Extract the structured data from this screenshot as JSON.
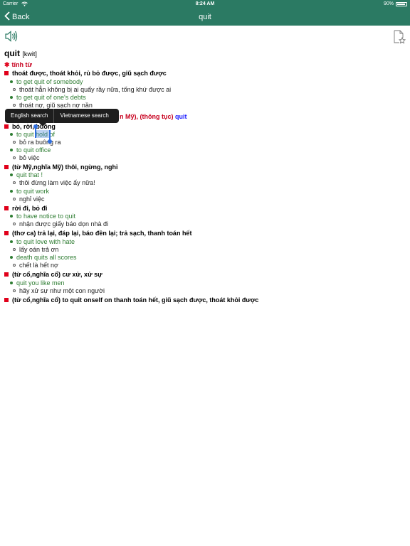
{
  "status_bar": {
    "carrier": "Carrier",
    "time": "8:24 AM",
    "battery": "90%"
  },
  "navbar": {
    "back_label": "Back",
    "title": "quit"
  },
  "icons": {
    "speaker": "speaker-icon",
    "bookmark": "bookmark-star-icon",
    "back": "chevron-left-icon",
    "wifi": "wifi-icon"
  },
  "colors": {
    "nav_bg": "#2b7a63",
    "sense_bullet": "#e0001a",
    "example": "#2e7d32",
    "pos": "#c8001e",
    "link": "#1a1aff"
  },
  "entry": {
    "word": "quit",
    "pronunciation": "[kwit]",
    "pos": "tính từ",
    "senses": [
      {
        "text": "thoát được, thoát khỏi, rủ bỏ được, giũ sạch được"
      },
      {
        "example": "to get quit of somebody"
      },
      {
        "translation": "thoát hẳn không bị ai quấy rầy nữa, tống khứ được ai"
      },
      {
        "example": "to get quit of one's debts"
      },
      {
        "translation": "thoát nợ, giũ sạch nợ nần"
      },
      {
        "partial_red": "n Mỹ), (thông tục)",
        "partial_blue": "quit"
      },
      {
        "text": "bỏ, rời, buông"
      },
      {
        "example": "to quit hold of",
        "selected_word": "hold"
      },
      {
        "translation": "bỏ ra buông ra"
      },
      {
        "example": "to quit office"
      },
      {
        "translation": "bỏ việc"
      },
      {
        "text": "(từ Mỹ,nghĩa Mỹ) thôi, ngừng, nghỉ"
      },
      {
        "example": "quit that !"
      },
      {
        "translation": "thôi đừng làm việc ấy nữa!"
      },
      {
        "example": "to quit work"
      },
      {
        "translation": "nghỉ việc"
      },
      {
        "text": "rời đi, bỏ đi"
      },
      {
        "example": "to have notice to quit"
      },
      {
        "translation": "nhận được giấy báo dọn nhà đi"
      },
      {
        "text": "(thơ ca) trả lại, đáp lại, báo đền lại; trả sạch, thanh toán hết"
      },
      {
        "example": "to quit love with hate"
      },
      {
        "translation": "lấy oán trả ơn"
      },
      {
        "example": "death quits all scores"
      },
      {
        "translation": "chết là hết nợ"
      },
      {
        "text": "(từ cổ,nghĩa cổ) cư xử, xử sự"
      },
      {
        "example": "quit you like men"
      },
      {
        "translation": "hãy xử sự như một con người"
      },
      {
        "text": "(từ cổ,nghĩa cổ) to quit onself on thanh toán hết, giũ sạch được, thoát khỏi được"
      }
    ]
  },
  "popup": {
    "english_search": "English search",
    "vietnamese_search": "Vietnamese search"
  }
}
